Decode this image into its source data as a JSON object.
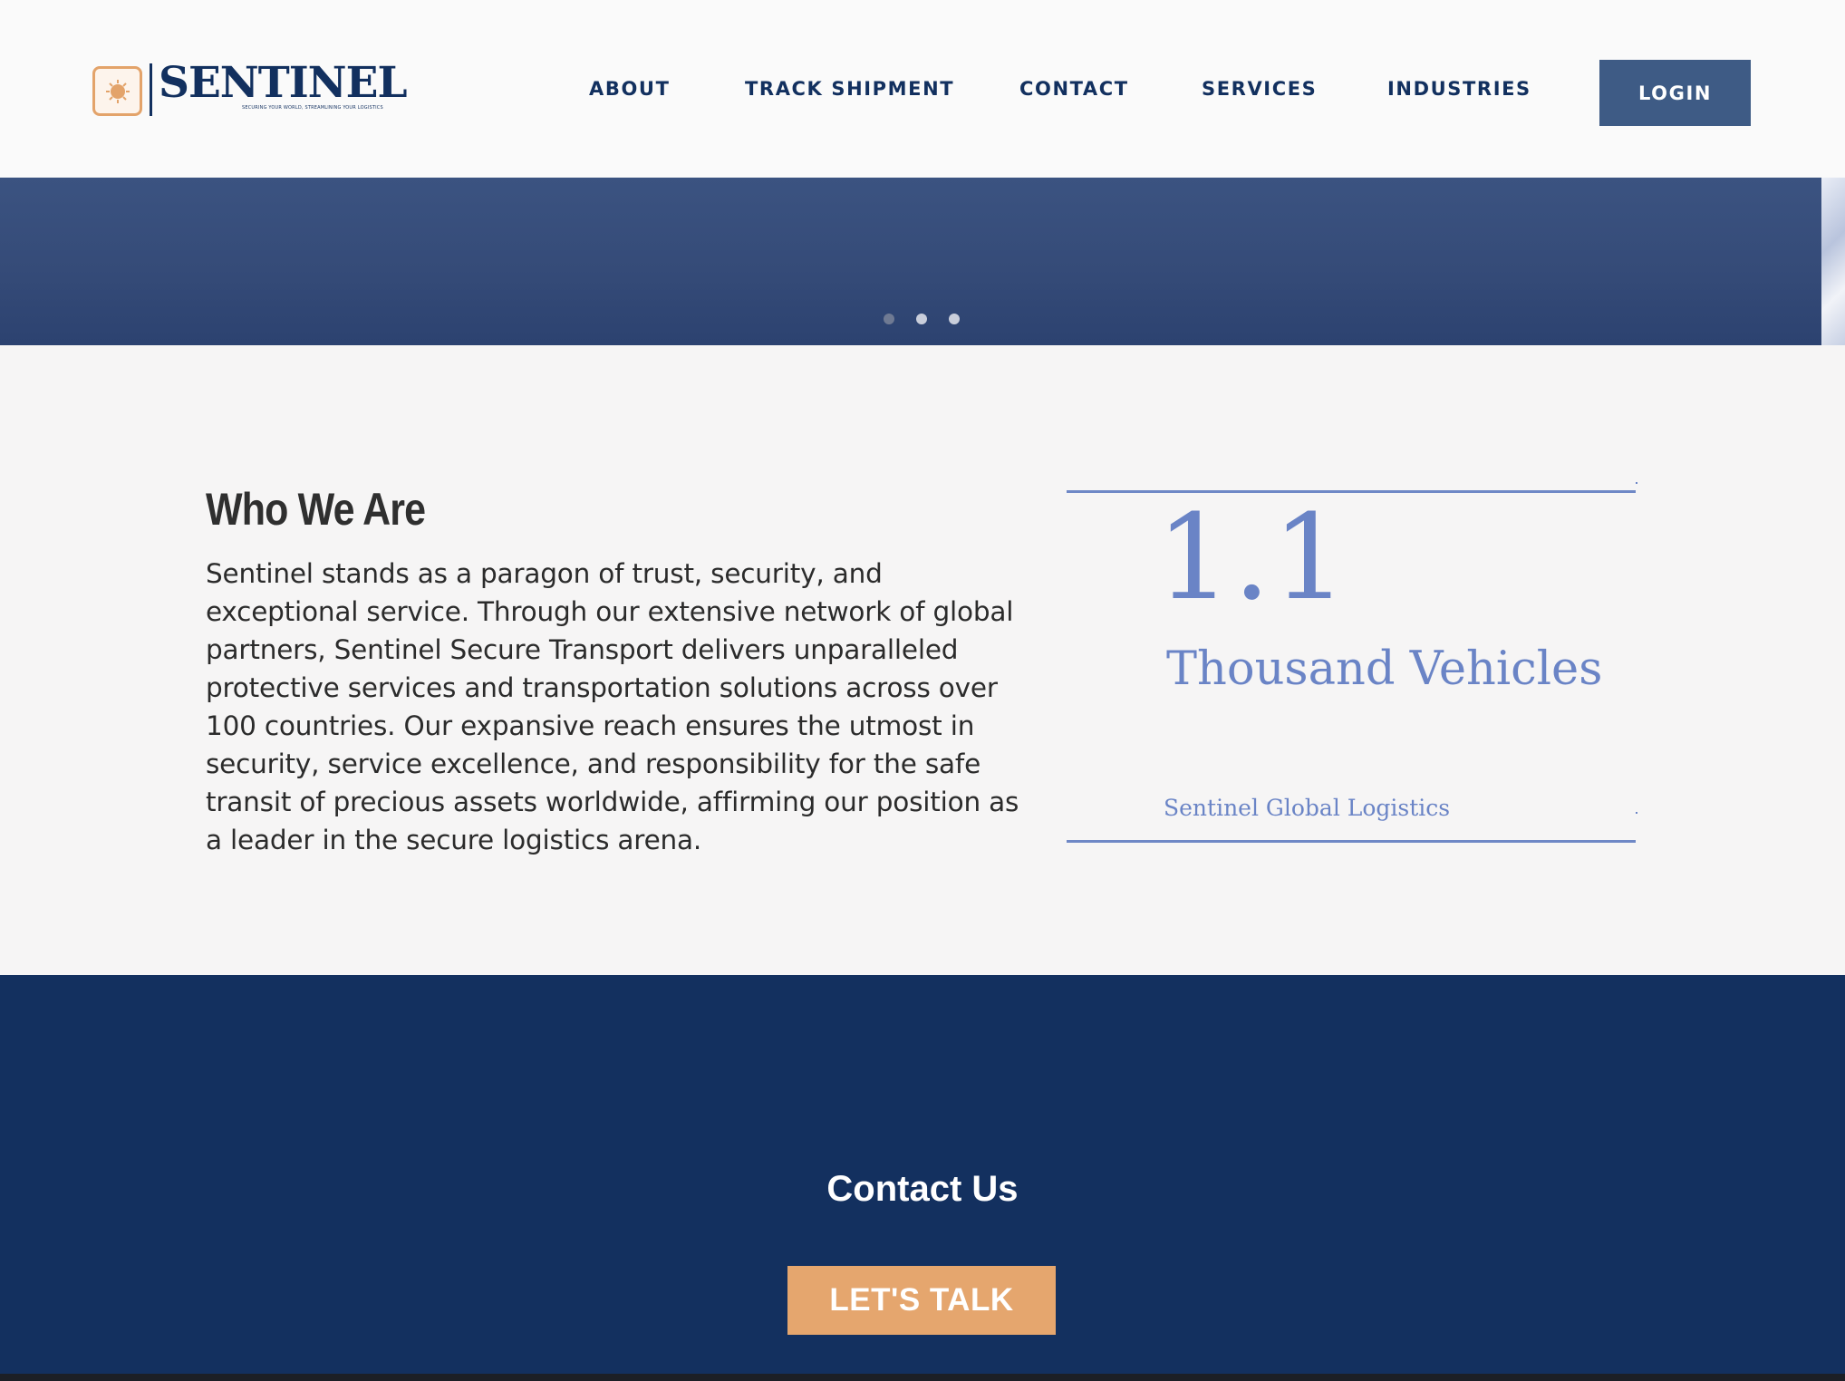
{
  "brand": {
    "name": "SENTINEL",
    "tagline": "SECURING YOUR WORLD, STREAMLINING YOUR LOGISTICS",
    "icon": "sun-emblem-icon",
    "accent": "#e3a36a",
    "primary": "#12305f"
  },
  "nav": {
    "items": [
      {
        "label": "ABOUT"
      },
      {
        "label": "TRACK SHIPMENT"
      },
      {
        "label": "CONTACT"
      },
      {
        "label": "SERVICES"
      },
      {
        "label": "INDUSTRIES"
      }
    ],
    "login_label": "LOGIN"
  },
  "hero": {
    "slide_count": 3,
    "active_slide": 1
  },
  "about": {
    "title": "Who We Are",
    "body": "Sentinel stands as a paragon of trust, security, and exceptional service. Through our extensive network of global partners, Sentinel Secure Transport delivers unparalleled protective services and transportation solutions across over 100 countries. Our expansive reach ensures the utmost in security, service excellence, and responsibility for the safe transit of precious assets worldwide, affirming our position as a leader in the secure logistics arena."
  },
  "stat": {
    "number": "1.1",
    "unit": "Thousand Vehicles",
    "caption": "Sentinel Global Logistics",
    "color": "#6a84c6"
  },
  "contact": {
    "title": "Contact Us",
    "cta_label": "LET'S TALK",
    "background": "#13305f",
    "button_color": "#e5a66e"
  }
}
